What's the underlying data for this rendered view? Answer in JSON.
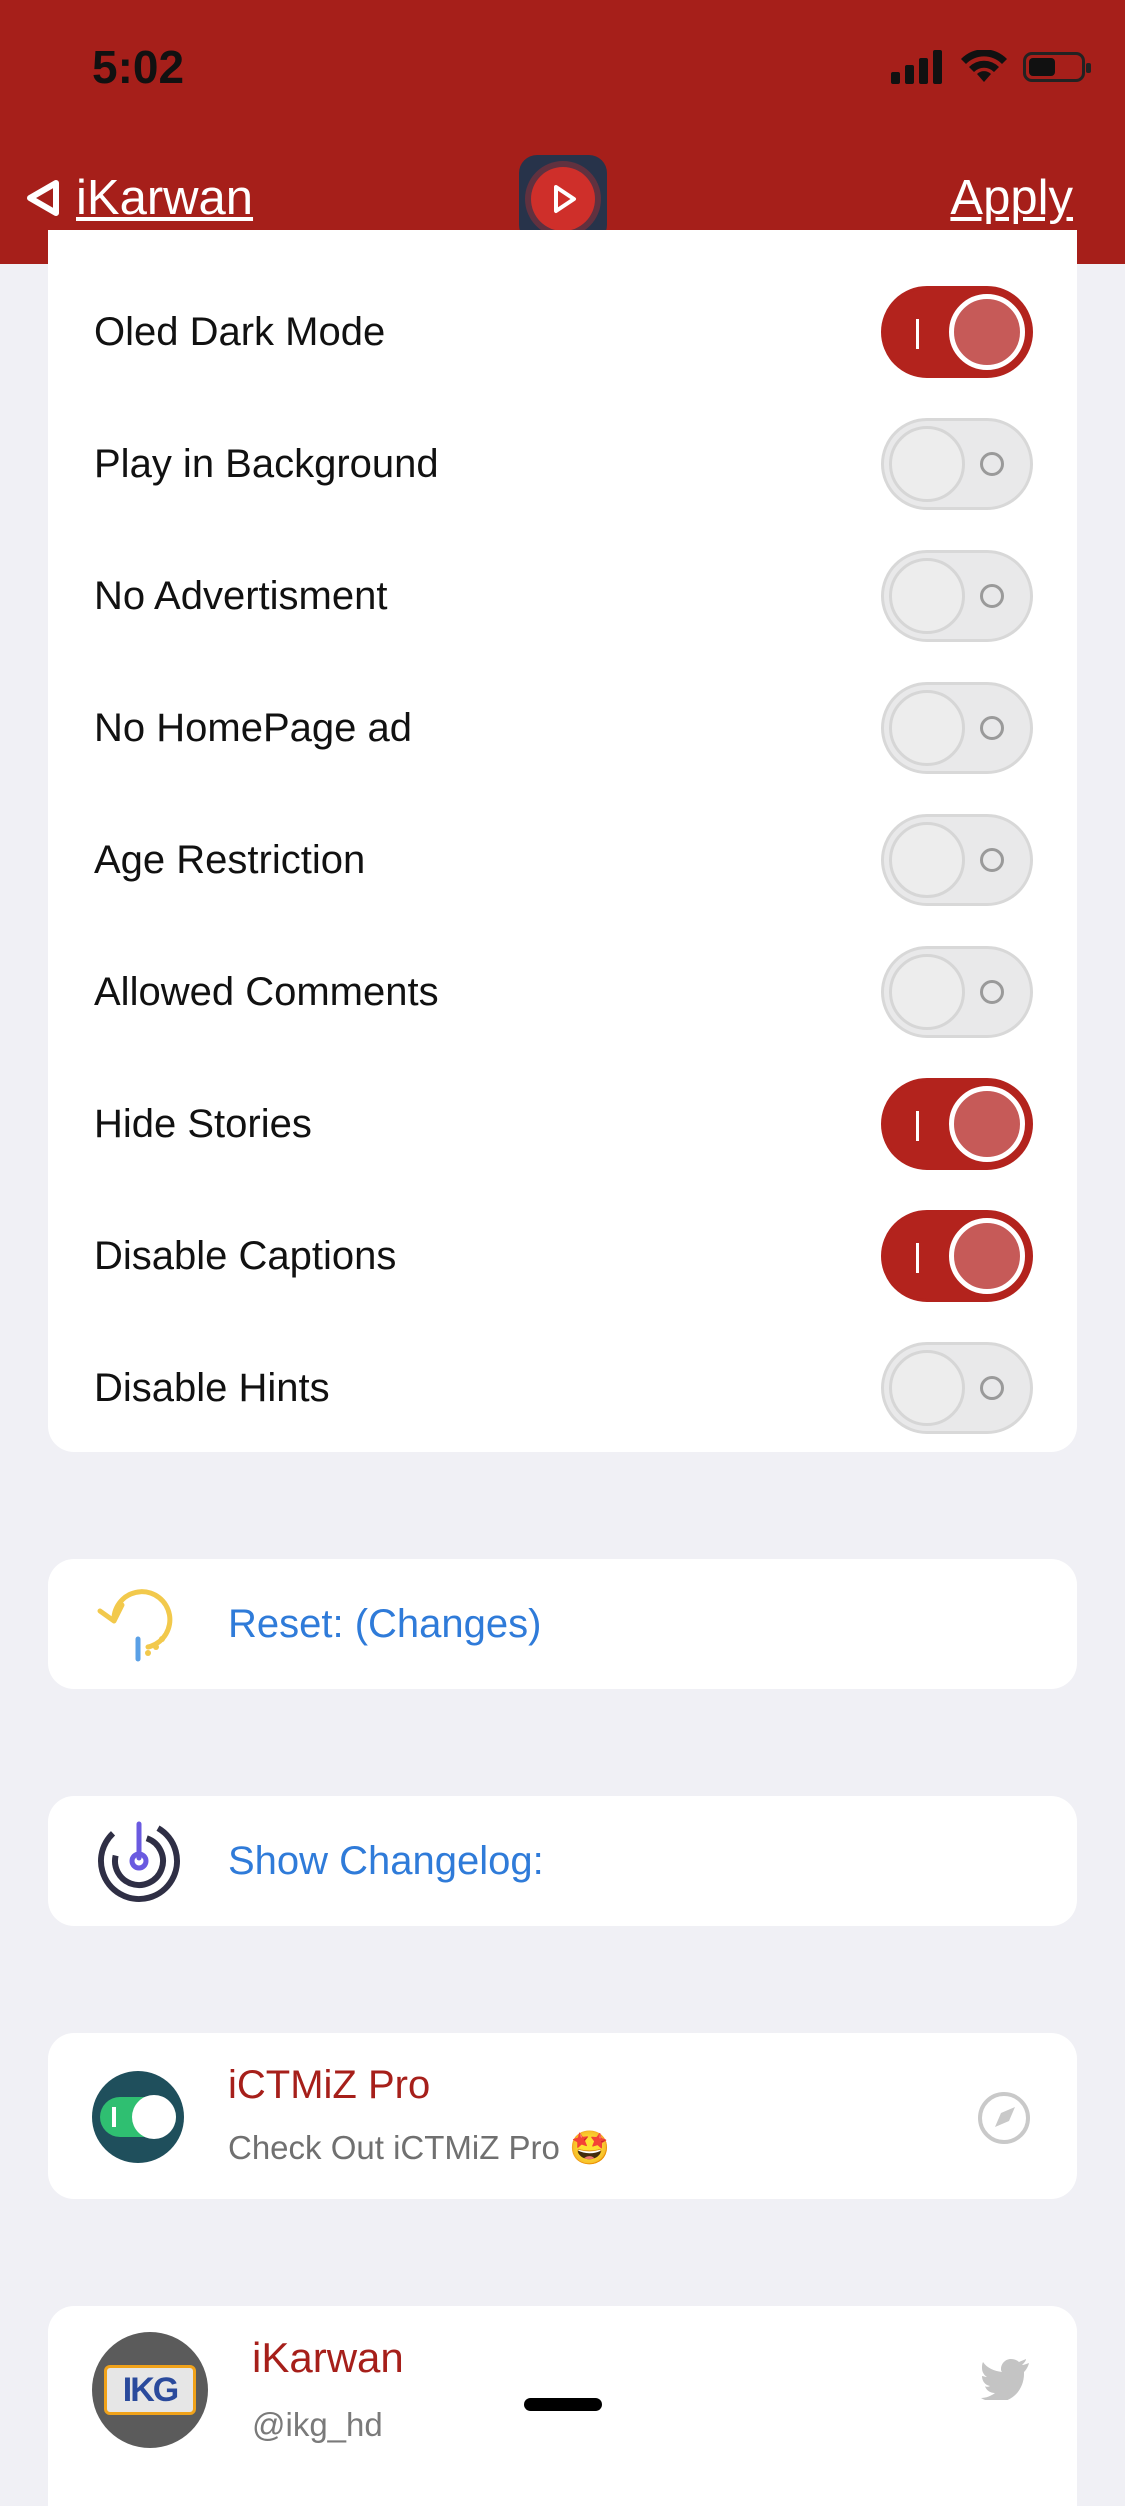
{
  "status_bar": {
    "time": "5:02"
  },
  "nav": {
    "back_label": "iKarwan",
    "apply_label": "Apply"
  },
  "settings": [
    {
      "label": "Oled Dark Mode",
      "on": true
    },
    {
      "label": "Play in Background",
      "on": false
    },
    {
      "label": "No Advertisment",
      "on": false
    },
    {
      "label": "No HomePage ad",
      "on": false
    },
    {
      "label": "Age Restriction",
      "on": false
    },
    {
      "label": "Allowed Comments",
      "on": false
    },
    {
      "label": "Hide Stories",
      "on": true
    },
    {
      "label": "Disable Captions",
      "on": true
    },
    {
      "label": "Disable Hints",
      "on": false
    }
  ],
  "links": {
    "reset_label": "Reset: (Changes)",
    "changelog_label": "Show Changelog:"
  },
  "promo": {
    "title": "iCTMiZ Pro",
    "subtitle": "Check Out iCTMiZ Pro 🤩"
  },
  "profile": {
    "name": "iKarwan",
    "handle": "@ikg_hd",
    "logo_text": "IKG"
  },
  "colors": {
    "brand_red": "#a61f1a",
    "toggle_on": "#b3231d",
    "link_blue": "#2f7bd9"
  }
}
